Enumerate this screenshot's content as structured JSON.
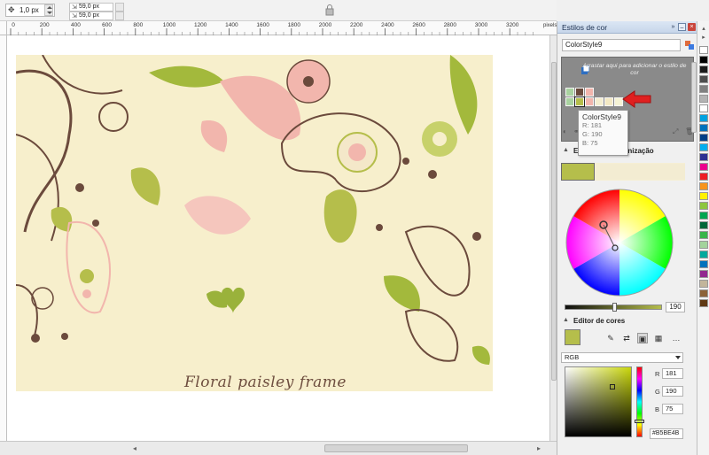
{
  "property_bar": {
    "nudge_value": "1,0 px",
    "duplicate_x": "59,0 px",
    "duplicate_y": "59,0 px"
  },
  "ruler": {
    "unit": "pixels",
    "ticks": [
      "0",
      "200",
      "400",
      "600",
      "800",
      "1000",
      "1200",
      "1400",
      "1600",
      "1800",
      "2000",
      "2200",
      "2400",
      "2600",
      "2800",
      "3000",
      "3200"
    ]
  },
  "artwork": {
    "title": "Floral paisley frame"
  },
  "docker": {
    "title": "Estilos de cor",
    "style_name": "ColorStyle9",
    "drop_hint": "Arrastar aqui para adicionar o estilo de cor",
    "harmony_section": "Editor de harmonização",
    "color_editor_section": "Editor de cores",
    "brightness": "190",
    "model": "RGB",
    "r_label": "R",
    "g_label": "G",
    "b_label": "B",
    "r_value": "181",
    "g_value": "190",
    "b_value": "75",
    "hex": "#B5BE4B"
  },
  "tooltip": {
    "title": "ColorStyle9",
    "r": "R: 181",
    "g": "G: 190",
    "b": "B: 75"
  },
  "swatches": {
    "row1": [
      "#a9d2a0",
      "#6b4a3c",
      "#f2b6ad"
    ],
    "row2": [
      "#b5be4b",
      "#f2b6ad",
      "#f4eed0",
      "#f3e9c4",
      "#f5f3d5"
    ]
  },
  "palette_colors": [
    "#ffffff",
    "#000000",
    "#1a1a1a",
    "#4d4d4d",
    "#808080",
    "#b3b3b3",
    "#ffffff",
    "#00a1e0",
    "#0072bc",
    "#003f87",
    "#00aeef",
    "#2e3192",
    "#ec008c",
    "#ed1c24",
    "#f7941d",
    "#fff200",
    "#8dc63f",
    "#00a651",
    "#006838",
    "#39b54a",
    "#a3d39c",
    "#00a99d",
    "#0072bc",
    "#92278f",
    "#c2b59b",
    "#8c6239",
    "#603913"
  ],
  "accent_colors": {
    "selected_style": "#b5be4b",
    "callout_arrow": "#e02020"
  },
  "icons": [
    "nudge-icon",
    "duplicate-icon",
    "lock-icon",
    "chevron-right-icon",
    "close-icon",
    "import-icon",
    "add-icon",
    "eyedropper-icon",
    "swap-icon",
    "sliders-icon",
    "palette-icon",
    "more-icon"
  ]
}
